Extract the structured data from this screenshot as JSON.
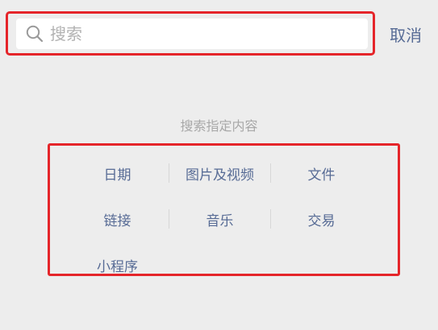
{
  "search": {
    "placeholder": "搜索",
    "value": ""
  },
  "cancel_label": "取消",
  "hint": "搜索指定内容",
  "categories": [
    {
      "label": "日期"
    },
    {
      "label": "图片及视频"
    },
    {
      "label": "文件"
    },
    {
      "label": "链接"
    },
    {
      "label": "音乐"
    },
    {
      "label": "交易"
    },
    {
      "label": "小程序"
    }
  ],
  "colors": {
    "accent": "#576b95",
    "highlight_border": "#e5252a",
    "background": "#ededed"
  }
}
